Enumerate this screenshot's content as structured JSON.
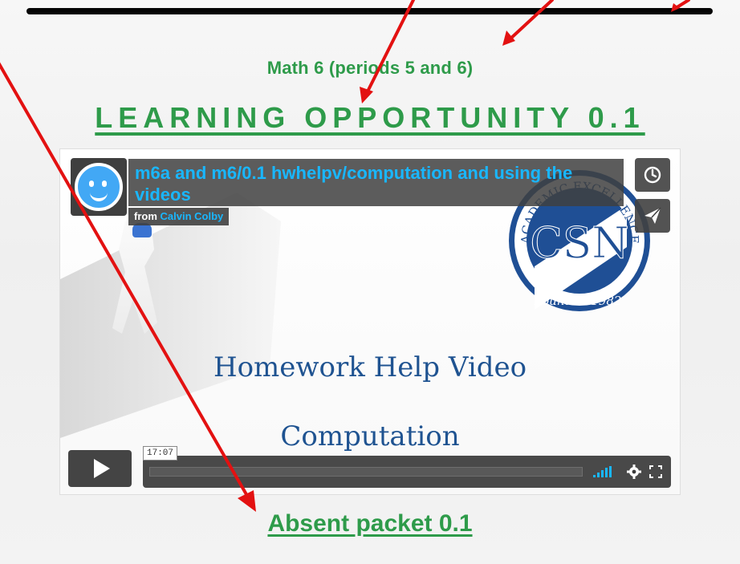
{
  "page": {
    "subtitle": "Math 6 (periods 5 and 6)",
    "heading": "LEARNING OPPORTUNITY 0.1",
    "link": "Absent packet 0.1"
  },
  "video": {
    "title": "m6a and m6/0.1 hwhelpv/computation and using the videos",
    "from_label": "from",
    "author": "Calvin Colby",
    "slide_title": "Homework Help Video",
    "slide_subtitle": "Computation",
    "logo": {
      "monogram": "CSN",
      "ring_text": "ACADEMIC EXCELLENCE",
      "founded": "Founded 1982"
    },
    "controls": {
      "time": "17:07"
    }
  },
  "colors": {
    "green": "#2e9b4a",
    "blue": "#19b7ff",
    "navy": "#1f5391",
    "red_arrow": "#e31111"
  },
  "icons": {
    "play": "play-icon",
    "watch_later": "clock-icon",
    "share": "paper-plane-icon",
    "volume": "volume-bars-icon",
    "settings": "gear-icon",
    "fullscreen": "fullscreen-icon"
  }
}
